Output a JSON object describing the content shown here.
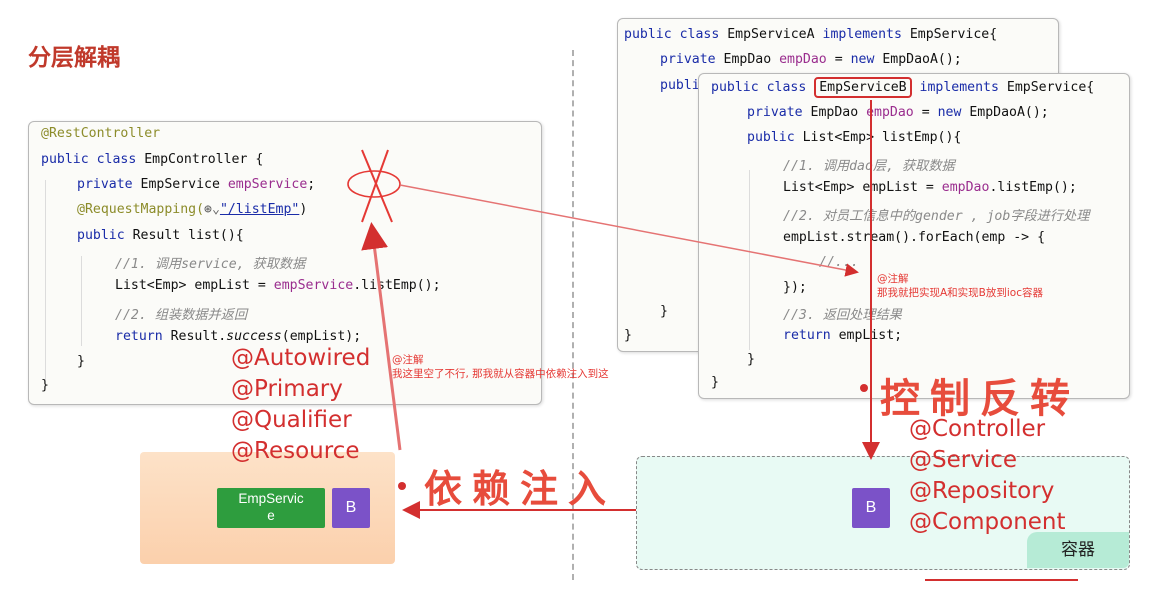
{
  "title": "分层解耦",
  "controller_code": {
    "line1": "@RestController",
    "line2_kw": "public class",
    "line2_rest": " EmpController {",
    "line3_kw": "private",
    "line3_type": " EmpService ",
    "line3_field": "empService",
    "line3_end": ";",
    "line4_ann": "@RequestMapping(",
    "line4_icon": "⊛⌄",
    "line4_str": "\"/listEmp\"",
    "line4_end": ")",
    "line5_kw": "public",
    "line5_rest": " Result list(){",
    "line6": "//1. 调用service, 获取数据",
    "line7_a": "List<Emp> empList = ",
    "line7_field": "empService",
    "line7_b": ".listEmp();",
    "line8": "//2. 组装数据并返回",
    "line9_kw": "return",
    "line9_a": " Result.",
    "line9_method": "success",
    "line9_b": "(empList);",
    "line10": "}",
    "line11": "}"
  },
  "serviceA_code": {
    "line1_kw": "public class",
    "line1_name": " EmpServiceA ",
    "line1_kw2": "implements",
    "line1_rest": " EmpService{",
    "line2_kw": "private",
    "line2_type": " EmpDao ",
    "line2_field": "empDao",
    "line2_eq": " = ",
    "line2_kw2": "new",
    "line2_rest": " EmpDaoA();",
    "line3": "publi",
    "close_inner": "}",
    "close_outer": "}"
  },
  "serviceB_code": {
    "line1_kw": "public class",
    "line1_name": "EmpServiceB",
    "line1_kw2": "implements",
    "line1_rest": " EmpService{",
    "line2_kw": "private",
    "line2_type": " EmpDao ",
    "line2_field": "empDao",
    "line2_eq": " = ",
    "line2_kw2": "new",
    "line2_rest": " EmpDaoA();",
    "line3_kw": "public",
    "line3_rest": " List<Emp> listEmp(){",
    "line4": "//1. 调用dao层, 获取数据",
    "line5_a": "List<Emp> empList = ",
    "line5_field": "empDao",
    "line5_b": ".listEmp();",
    "line6": "//2. 对员工信息中的gender , job字段进行处理",
    "line7": "empList.stream().forEach(emp -> {",
    "line8": "//...",
    "line9": "});",
    "line10": "//3. 返回处理结果",
    "line11_kw": "return",
    "line11_rest": " empList;",
    "line12": "}",
    "line13": "}"
  },
  "notes": {
    "note_left_title": "@注解",
    "note_left_body": "我这里空了不行, 那我就从容器中依赖注入到这",
    "note_right_title": "@注解",
    "note_right_body": "那我就把实现A和实现B放到ioc容器"
  },
  "di_annotations": [
    "@Autowired",
    "@Primary",
    "@Qualifier",
    "@Resource"
  ],
  "ioc_annotations": [
    "@Controller",
    "@Service",
    "@Repository",
    "@Component"
  ],
  "ioc_label": "控制反转",
  "di_label": "依赖注入",
  "left_bean": {
    "label_line1": "EmpServic",
    "label_line2": "e",
    "b_label": "B"
  },
  "container": {
    "b_label": "B",
    "tag": "容器"
  },
  "colors": {
    "accent_red": "#d32f2f",
    "bean_purple": "#7b52c8",
    "tag_green": "#2e9d3e",
    "container_bg": "#e8faf4",
    "left_bg": "#fde2c8"
  }
}
